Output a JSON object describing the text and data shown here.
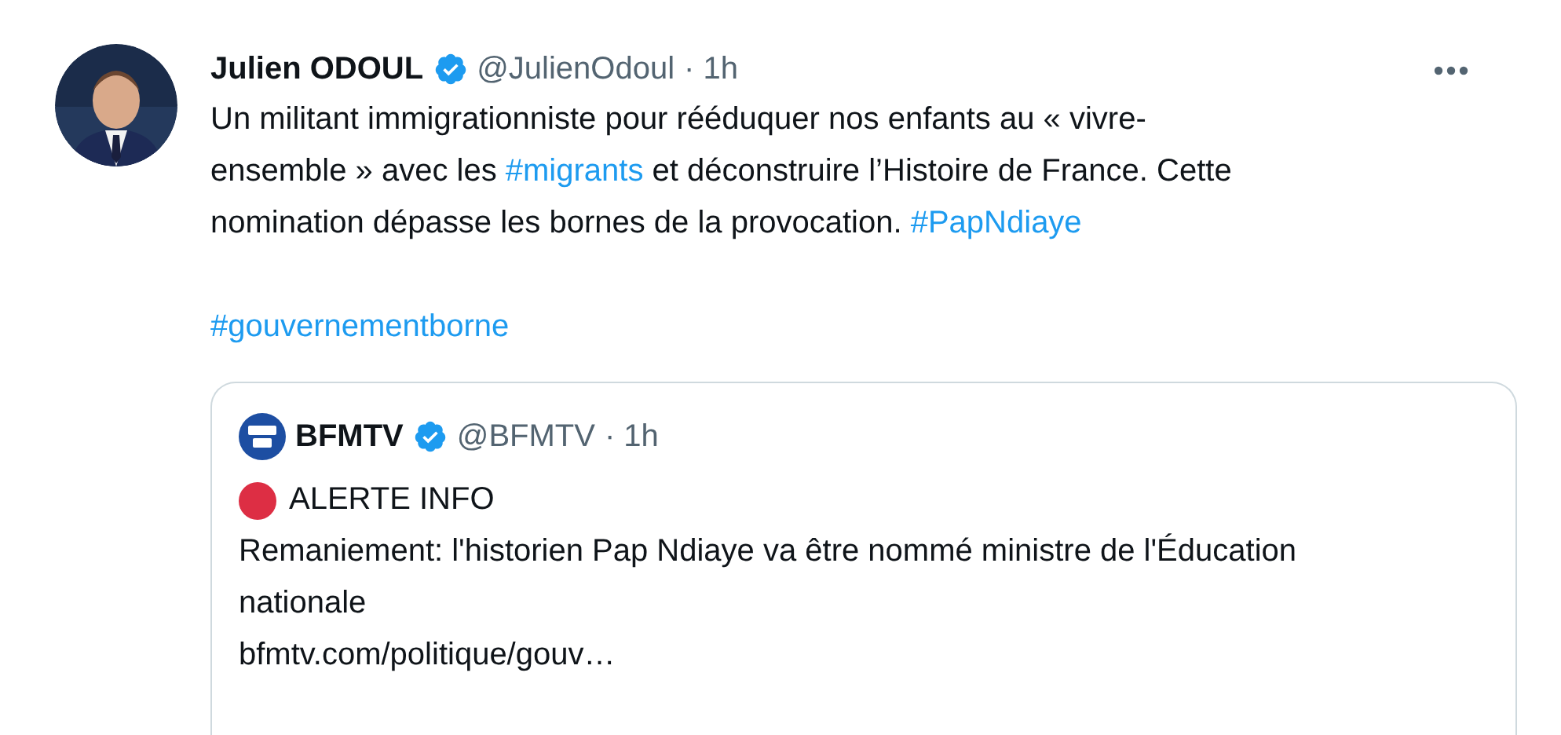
{
  "tweet": {
    "author": {
      "name": "Julien ODOUL",
      "verified": true,
      "handle": "@JulienOdoul",
      "time": "· 1h"
    },
    "paragraphs": [
      [
        {
          "kind": "text",
          "text": "Un militant immigrationniste pour rééduquer nos enfants au « vivre-ensemble » avec les "
        },
        {
          "kind": "hashtag",
          "text": "#migrants"
        },
        {
          "kind": "text",
          "text": " et déconstruire l’Histoire de France. Cette nomination dépasse les bornes de la provocation. "
        },
        {
          "kind": "hashtag",
          "text": "#PapNdiaye"
        }
      ],
      [
        {
          "kind": "hashtag",
          "text": "#gouvernementborne"
        }
      ]
    ],
    "quote": {
      "author": {
        "name": "BFMTV",
        "verified": true,
        "handle": "@BFMTV",
        "time": "· 1h"
      },
      "alert": {
        "color": "#dd2e44",
        "text": "ALERTE INFO"
      },
      "text": "Remaniement: l'historien Pap Ndiaye va être nommé ministre de l'Éducation nationale",
      "link": "bfmtv.com/politique/gouv…"
    }
  }
}
